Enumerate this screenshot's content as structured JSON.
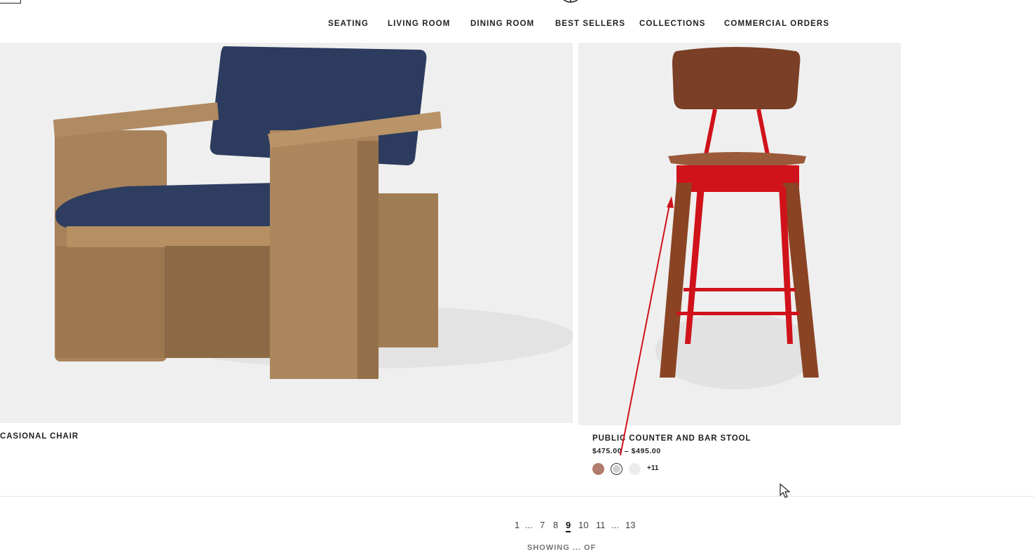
{
  "nav": {
    "items": [
      "SEATING",
      "LIVING ROOM",
      "DINING ROOM",
      "BEST SELLERS",
      "COLLECTIONS",
      "COMMERCIAL ORDERS"
    ]
  },
  "products": [
    {
      "title": "CASIONAL CHAIR",
      "price": ""
    },
    {
      "title": "PUBLIC COUNTER AND BAR STOOL",
      "price": "$475.00 – $495.00",
      "swatches": [
        "#b07d6c",
        "#cfcfcf",
        "#ececec"
      ],
      "more_colors": "+11"
    }
  ],
  "pagination": {
    "pages": [
      "1",
      "...",
      "7",
      "8",
      "9",
      "10",
      "11",
      "...",
      "13"
    ],
    "current": "9"
  },
  "footer_text": "SHOWING ... OF",
  "colors": {
    "accent_red": "#d0121b",
    "bg_gray": "#efefef"
  }
}
